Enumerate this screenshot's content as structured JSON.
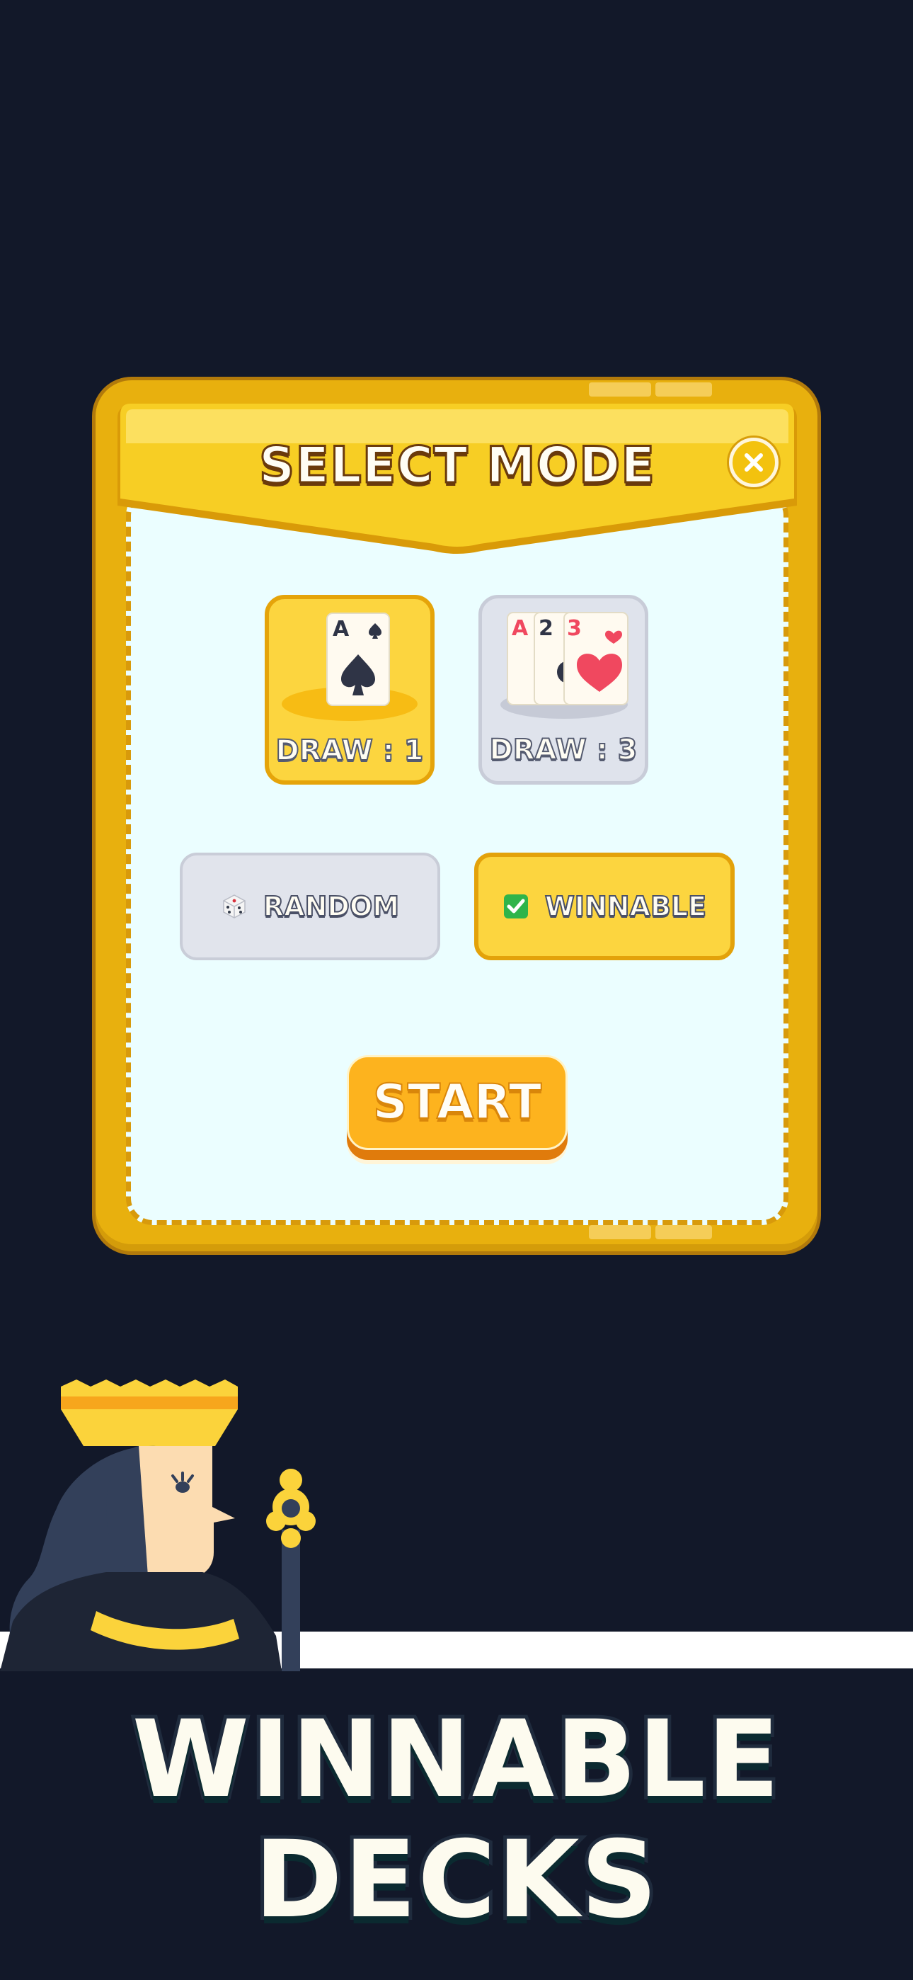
{
  "dialog": {
    "title": "SELECT MODE",
    "close_icon": "close-icon",
    "draw_options": [
      {
        "label": "DRAW : 1",
        "selected": true,
        "cards": [
          "A"
        ]
      },
      {
        "label": "DRAW : 3",
        "selected": false,
        "cards": [
          "A",
          "2",
          "3"
        ]
      }
    ],
    "deal_options": [
      {
        "label": "RANDOM",
        "icon": "dice-icon",
        "selected": false
      },
      {
        "label": "WINNABLE",
        "icon": "check-icon",
        "selected": true
      }
    ],
    "start_label": "START"
  },
  "promo": {
    "line1": "WINNABLE",
    "line2": "DECKS"
  },
  "colors": {
    "background": "#121829",
    "dialog_gold": "#e8b00e",
    "panel": "#ebfeff",
    "selected": "#fcd53f",
    "unselected": "#dfe3ec",
    "start": "#fdb31e",
    "suit_red": "#f0485f",
    "suit_black": "#2f3446"
  }
}
